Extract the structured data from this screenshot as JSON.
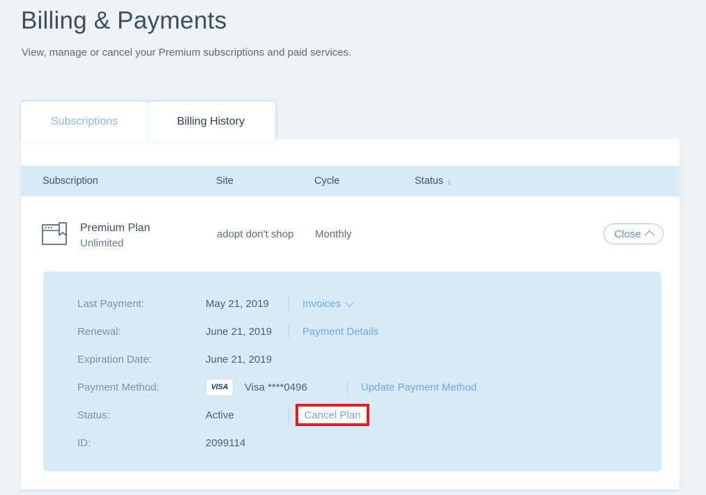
{
  "page": {
    "title": "Billing & Payments",
    "subtitle": "View, manage or cancel your Premium subscriptions and paid services."
  },
  "tabs": [
    {
      "label": "Subscriptions",
      "active": true
    },
    {
      "label": "Billing History",
      "active": false
    }
  ],
  "table": {
    "headers": {
      "subscription": "Subscription",
      "site": "Site",
      "cycle": "Cycle",
      "status": "Status",
      "sort_arrow": "↓"
    },
    "row": {
      "icon": "browser-bookmark-icon",
      "name": "Premium Plan",
      "tier": "Unlimited",
      "site": "adopt don't shop",
      "cycle": "Monthly",
      "action_label": "Close"
    }
  },
  "details": {
    "last_payment": {
      "label": "Last Payment:",
      "value": "May 21, 2019",
      "link": "Invoices"
    },
    "renewal": {
      "label": "Renewal:",
      "value": "June 21, 2019",
      "link": "Payment Details"
    },
    "expiration": {
      "label": "Expiration Date:",
      "value": "June 21, 2019"
    },
    "payment_method": {
      "label": "Payment Method:",
      "brand_badge": "VISA",
      "value": "Visa ****0496",
      "link": "Update Payment Method"
    },
    "status": {
      "label": "Status:",
      "value": "Active",
      "link": "Cancel Plan"
    },
    "id": {
      "label": "ID:",
      "value": "2099114"
    }
  },
  "colors": {
    "page_background": "#eef2f5",
    "card_background": "#ffffff",
    "accent_blue": "#d7eaf8",
    "link_blue": "#6faadc",
    "active_tab_text": "#8bb8dd",
    "annotation_red": "#e01f1f",
    "title_text": "#3d4e5c"
  }
}
